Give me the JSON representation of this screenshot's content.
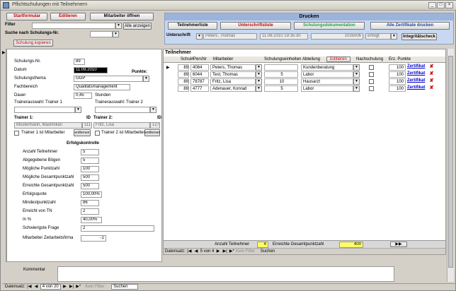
{
  "window": {
    "title": "Pflichtschulungen mit Teilnehmern"
  },
  "header": {
    "btn_startformular": "Startformular",
    "btn_editieren": "Editieren",
    "btn_mitarbeiter": "Mitarbeiter öffnen",
    "filter_label": "Filter",
    "filter_value": "",
    "alle_anzeigen": "Alle anzeigen",
    "suche_label": "Suche nach Schulungs-Nr.",
    "suche_value": "",
    "schulung_kopieren": "Schulung kopieren"
  },
  "drucken": {
    "head": "Drucken",
    "teilnehmerliste": "Teilnehmerliste",
    "unterschriftsliste": "Unterschriftsliste",
    "schulungsdokumentation": "Schulungsdokumentation",
    "alle_zertifikate": "Alle Zertifikate drucken",
    "unterschrift_label": "Unterschrift",
    "unterschrift_value": "Peters, Thomas",
    "datum_value": "11.08.2010 19:35:30",
    "nr_value": "1035006",
    "status_value": "erfolgt",
    "integritaet": "Integritätscheck"
  },
  "form": {
    "schulungs_nr_label": "Schulungs-Nr.",
    "schulungs_nr": "89",
    "datum_label": "Datum",
    "datum": "11.09.2010",
    "punkte_label": "Punkte:",
    "thema_label": "Schulungsthema",
    "thema": "GGP",
    "fachbereich_label": "Fachbereich",
    "fachbereich": "Qualitätsmanagement",
    "dauer_label": "Dauer",
    "dauer": "0,45",
    "stunden_label": "Stunden",
    "trainer1_auswahl_label": "Trainerauswahl: Trainer 1",
    "trainer2_auswahl_label": "Trainerauswahl: Trainer 2",
    "trainer1_label": "Trainer 1:",
    "id_label": "ID",
    "trainer1_name": "Mustermann, Maximilian",
    "trainer1_id": "111",
    "trainer2_label": "Trainer 2:",
    "trainer2_name": "Fritz, Lisa",
    "trainer2_id": "127",
    "trainer1_mitarbeiter": "Trainer 1 ist Mitarbeiter",
    "trainer2_mitarbeiter": "Trainer 2 ist Mitarbeiter",
    "entfernen": "entfernen"
  },
  "erfolg": {
    "title": "Erfolgskontrolle",
    "rows": [
      {
        "label": "Anzahl Teilnehmer",
        "value": "5"
      },
      {
        "label": "Abgegebene Bögen",
        "value": "5"
      },
      {
        "label": "Mögliche Punktzahl",
        "value": "100"
      },
      {
        "label": "Mögliche Gesamtpunktzahl",
        "value": "500"
      },
      {
        "label": "Erreichte Gesamtpunktzahl",
        "value": "500"
      },
      {
        "label": "Erfolgsquote",
        "value": "100,00%"
      },
      {
        "label": "Mindestpunktzahl",
        "value": "86"
      },
      {
        "label": "Erreicht von TN",
        "value": "2"
      },
      {
        "label": "In %",
        "value": "40,00%"
      },
      {
        "label": "Schwierigste Frage",
        "value": "2"
      },
      {
        "label": "Mitarbeiter Zeitarbeitsfirma",
        "value": "-1"
      }
    ]
  },
  "teilnehmer": {
    "title": "Teilnehmer",
    "editieren": "Editieren",
    "columns": [
      "Schul#",
      "PersNr",
      "Mitarbeiter",
      "Schulungseinheiten",
      "Abteilung",
      "",
      "Nachschulung",
      "Erz. Punkte"
    ],
    "rows": [
      {
        "schul": "89",
        "persnr": "4084",
        "name": "Peters, Thomas",
        "einh": "",
        "abt": "Kundenberatung",
        "punkte": "100",
        "zert": "Zertifikat"
      },
      {
        "schul": "89",
        "persnr": "6044",
        "name": "Test, Thomas",
        "einh": "5",
        "abt": "Labor",
        "punkte": "100",
        "zert": "Zertifikat"
      },
      {
        "schul": "89",
        "persnr": "78787",
        "name": "Fritz, Lisa",
        "einh": "10",
        "abt": "Hausarzt",
        "punkte": "100",
        "zert": "Zertifikat"
      },
      {
        "schul": "89",
        "persnr": "4777",
        "name": "Adenauer, Konrad",
        "einh": "5",
        "abt": "Labor",
        "punkte": "100",
        "zert": "Zertifikat"
      }
    ],
    "anzahl_label": "Anzahl Teilnehmer",
    "anzahl_value": "4",
    "gesamt_label": "Erreichte Gesamtpunktzahl",
    "gesamt_value": "400",
    "nav_label": "Datensatz:",
    "nav_pos": "5 von 4",
    "kein_filter": "Kein Filter",
    "suchen": "Suchen"
  },
  "kommentar": {
    "label": "Kommentar"
  },
  "statusbar": {
    "nav_label": "Datensatz:",
    "nav_pos": "4 von 20",
    "kein_filter": "Kein Filter",
    "suchen": "Suchen"
  }
}
